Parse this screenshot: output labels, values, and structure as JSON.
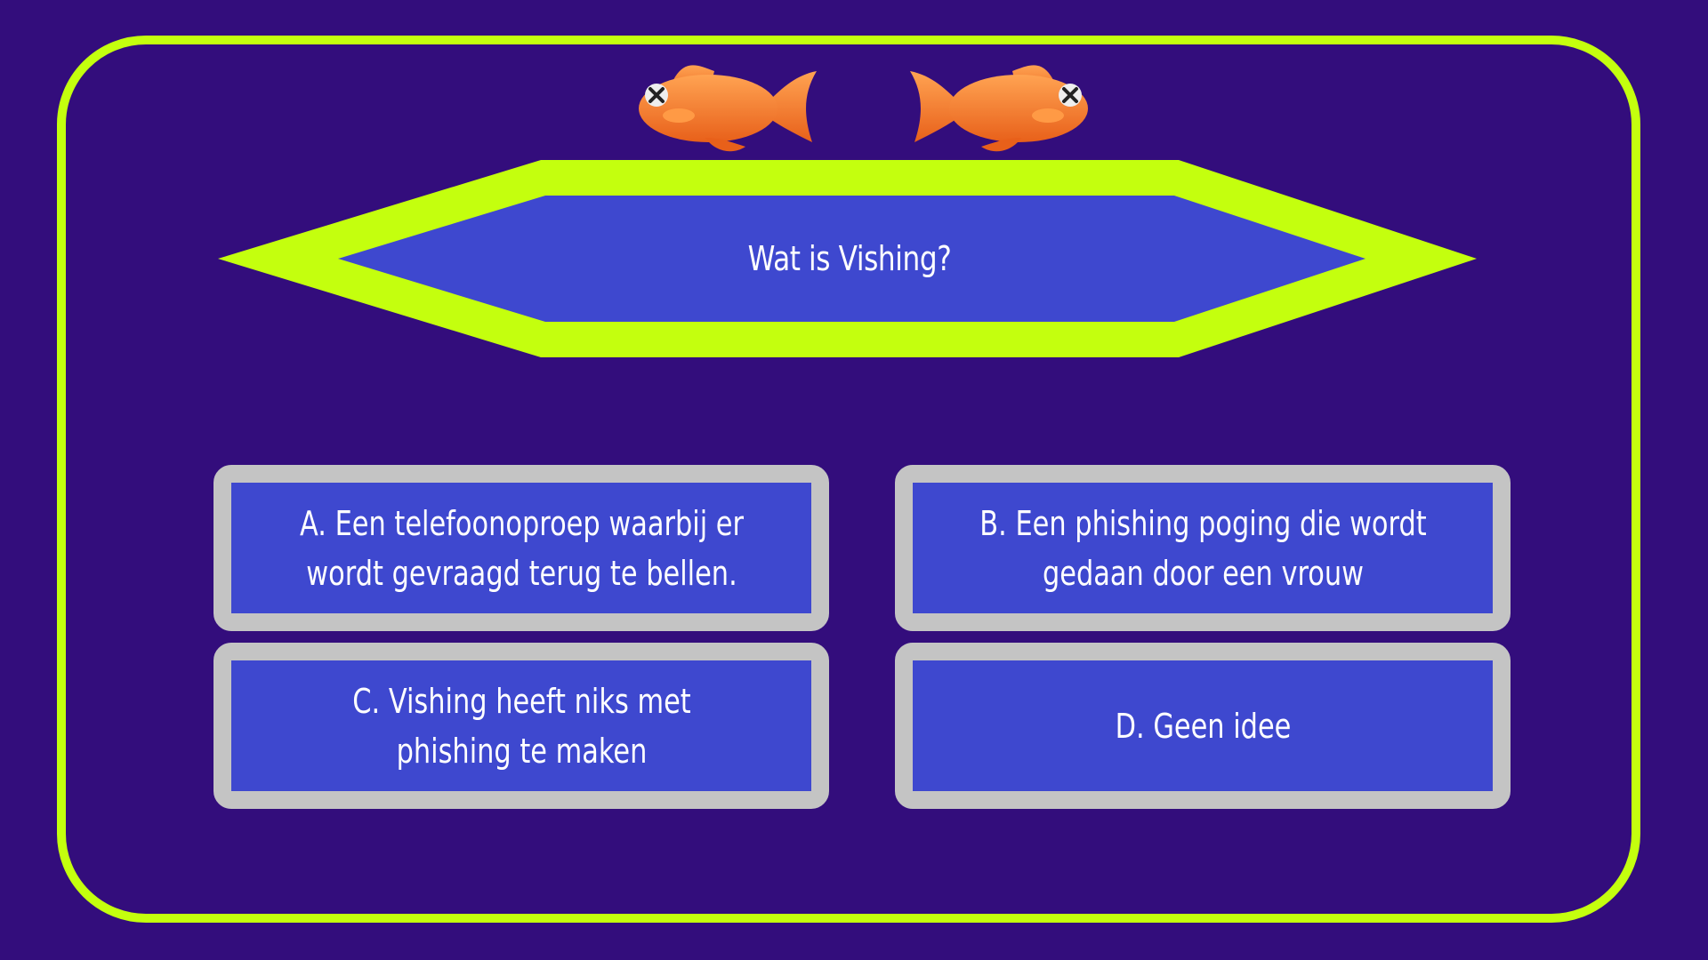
{
  "quiz": {
    "question": "Wat is Vishing?",
    "answers": [
      {
        "label": "A. Een telefoonoproep waarbij er\nwordt gevraagd terug te bellen."
      },
      {
        "label": "B. Een phishing poging die wordt\ngedaan door een vrouw"
      },
      {
        "label": "C. Vishing heeft niks met\nphishing te maken"
      },
      {
        "label": "D. Geen idee"
      }
    ]
  },
  "icons": {
    "lifeline_left": "dead-goldfish-icon",
    "lifeline_right": "dead-goldfish-icon"
  },
  "colors": {
    "background": "#330d7c",
    "frame": "#c4ff0e",
    "panel": "#3e48cf",
    "answer_border": "#c4c4c4",
    "fish": "#ff8a2e",
    "text": "#ffffff"
  }
}
